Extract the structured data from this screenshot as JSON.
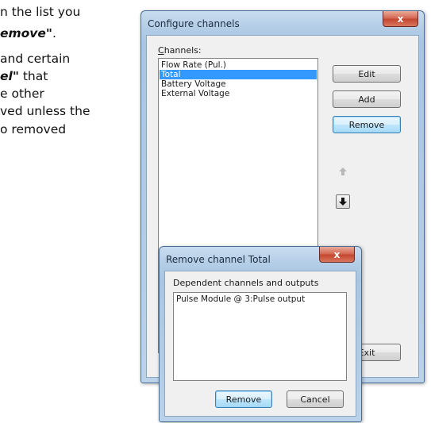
{
  "document": {
    "lines": [
      {
        "parts": [
          {
            "text": "n the list you",
            "style": "normal"
          }
        ]
      },
      {
        "parts": [
          {
            "text": "emove\"",
            "style": "bi"
          },
          {
            "text": ".",
            "style": "normal"
          }
        ]
      },
      {
        "parts": [
          {
            "text": "and certain",
            "style": "normal"
          }
        ]
      },
      {
        "parts": [
          {
            "text": "el\"",
            "style": "bi"
          },
          {
            "text": " that",
            "style": "normal"
          }
        ]
      },
      {
        "parts": [
          {
            "text": "e other",
            "style": "normal"
          }
        ]
      },
      {
        "parts": [
          {
            "text": "ved unless the",
            "style": "normal"
          }
        ]
      },
      {
        "parts": [
          {
            "text": "o removed",
            "style": "normal"
          }
        ]
      }
    ]
  },
  "configure_dialog": {
    "title": "Configure channels",
    "close_glyph": "x",
    "channels_label": "Channels:",
    "channels_label_mnemonic": "C",
    "channels_label_rest": "hannels:",
    "channels": [
      "Flow Rate (Pul.)",
      "Total",
      "Battery Voltage",
      "External Voltage"
    ],
    "selected_index": 1,
    "buttons": {
      "edit": "Edit",
      "add": "Add",
      "remove": "Remove",
      "exit": "Exit"
    },
    "move_up_icon": "arrow-up-icon",
    "move_down_icon": "arrow-down-icon"
  },
  "remove_dialog": {
    "title": "Remove channel Total",
    "close_glyph": "x",
    "dependents_label": "Dependent channels and outputs",
    "dependents": [
      "Pulse Module @ 3:Pulse output"
    ],
    "buttons": {
      "remove": "Remove",
      "cancel": "Cancel"
    }
  },
  "colors": {
    "selection": "#3399ff",
    "close_button": "#c44730",
    "frame": "#a9c5e2",
    "focus_button": "#bee6fd"
  }
}
